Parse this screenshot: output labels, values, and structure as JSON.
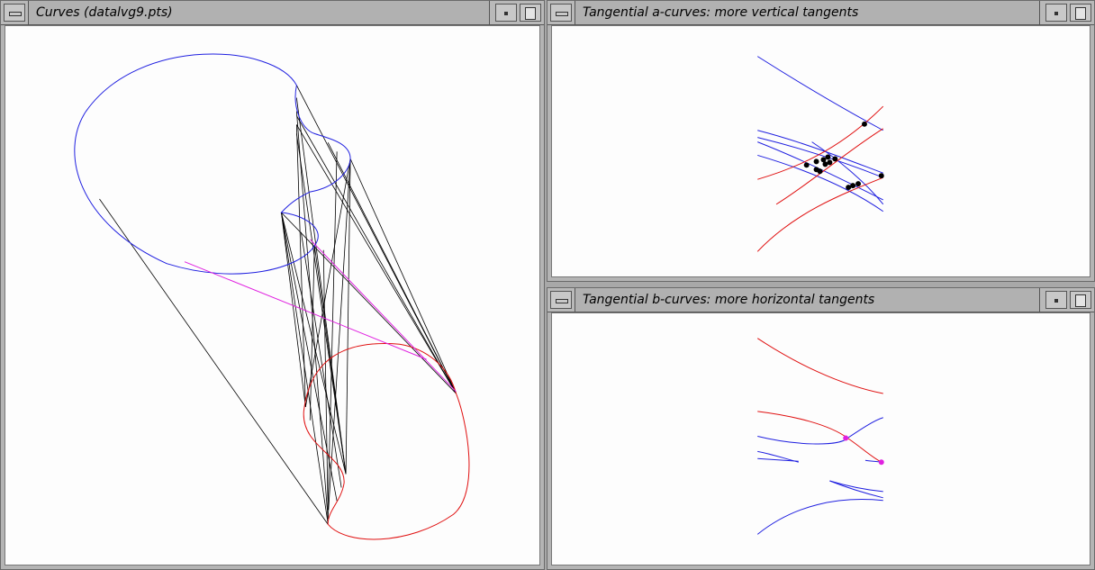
{
  "windows": {
    "curves": {
      "title": "Curves (datalvg9.pts)"
    },
    "tan_a": {
      "title": "Tangential a-curves: more vertical tangents"
    },
    "tan_b": {
      "title": "Tangential b-curves: more horizontal tangents"
    }
  },
  "colors": {
    "curve_a": "#2020e0",
    "curve_b": "#e01010",
    "connector": "#000000",
    "highlight": "#e020e0",
    "window_frame": "#b4b4b4",
    "canvas": "#fdfdfd"
  },
  "icons": [
    "window-menu-icon",
    "minimize-icon",
    "maximize-icon"
  ]
}
